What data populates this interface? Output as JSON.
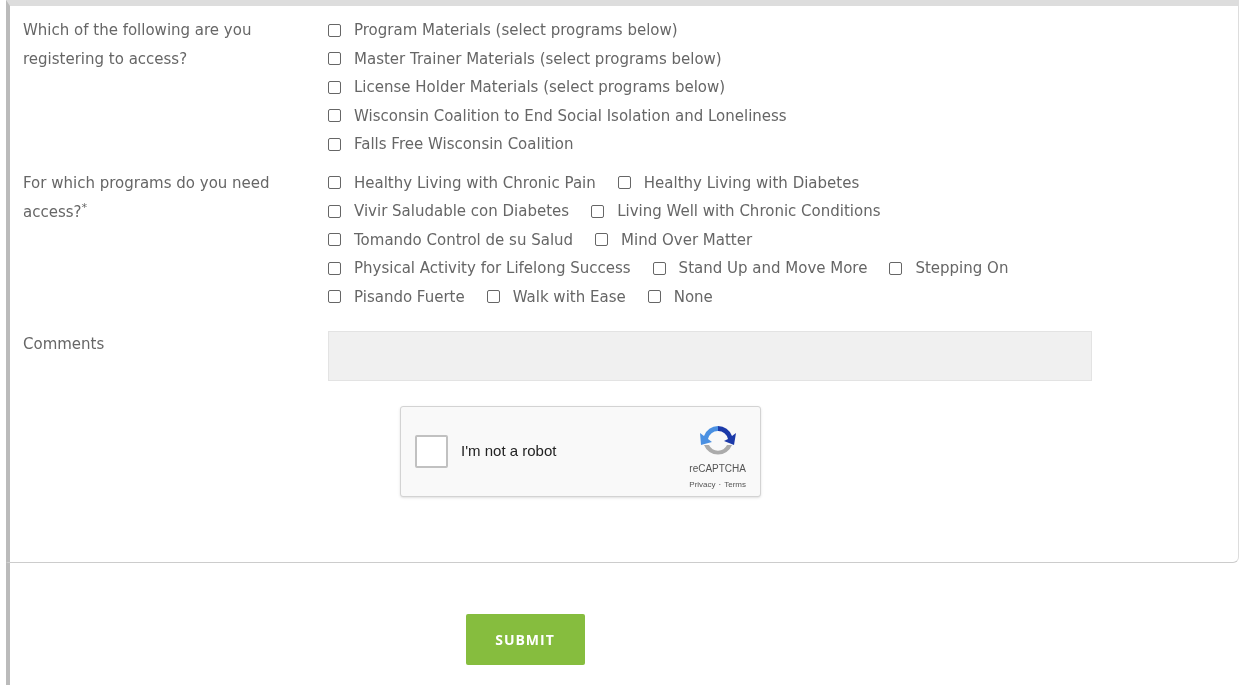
{
  "questions": [
    {
      "label": "Which of the following are you registering to access?",
      "lines": [
        [
          {
            "label": "Program Materials (select programs below)",
            "checked": false
          }
        ],
        [
          {
            "label": "Master Trainer Materials (select programs below)",
            "checked": false
          }
        ],
        [
          {
            "label": "License Holder Materials (select programs below)",
            "checked": false
          }
        ],
        [
          {
            "label": "Wisconsin Coalition to End Social Isolation and Loneliness",
            "checked": false
          }
        ],
        [
          {
            "label": "Falls Free Wisconsin Coalition",
            "checked": false
          }
        ]
      ]
    },
    {
      "label": "For which programs do you need access?$^{*}$",
      "lines": [
        [
          {
            "label": "Healthy Living with Chronic Pain",
            "checked": false
          },
          {
            "label": "Healthy Living with Diabetes",
            "checked": false
          }
        ],
        [
          {
            "label": "Vivir Saludable con Diabetes",
            "checked": false
          },
          {
            "label": "Living Well with Chronic Conditions",
            "checked": false
          }
        ],
        [
          {
            "label": "Tomando Control de su Salud",
            "checked": false
          },
          {
            "label": "Mind Over Matter",
            "checked": false
          }
        ],
        [
          {
            "label": "Physical Activity for Lifelong Success",
            "checked": false
          },
          {
            "label": "Stand Up and Move More",
            "checked": false
          },
          {
            "label": "Stepping On",
            "checked": false
          }
        ],
        [
          {
            "label": "Pisando Fuerte",
            "checked": false
          },
          {
            "label": "Walk with Ease",
            "checked": false
          },
          {
            "label": "None",
            "checked": false
          }
        ]
      ]
    }
  ],
  "comments": {
    "label": "Comments"
  },
  "captcha": {
    "checked": false,
    "label": "I'm not a robot",
    "brand": "reCAPTCHA",
    "links": [
      "Privacy",
      "Terms"
    ],
    "separator": "·"
  },
  "submit": "SUBMIT"
}
